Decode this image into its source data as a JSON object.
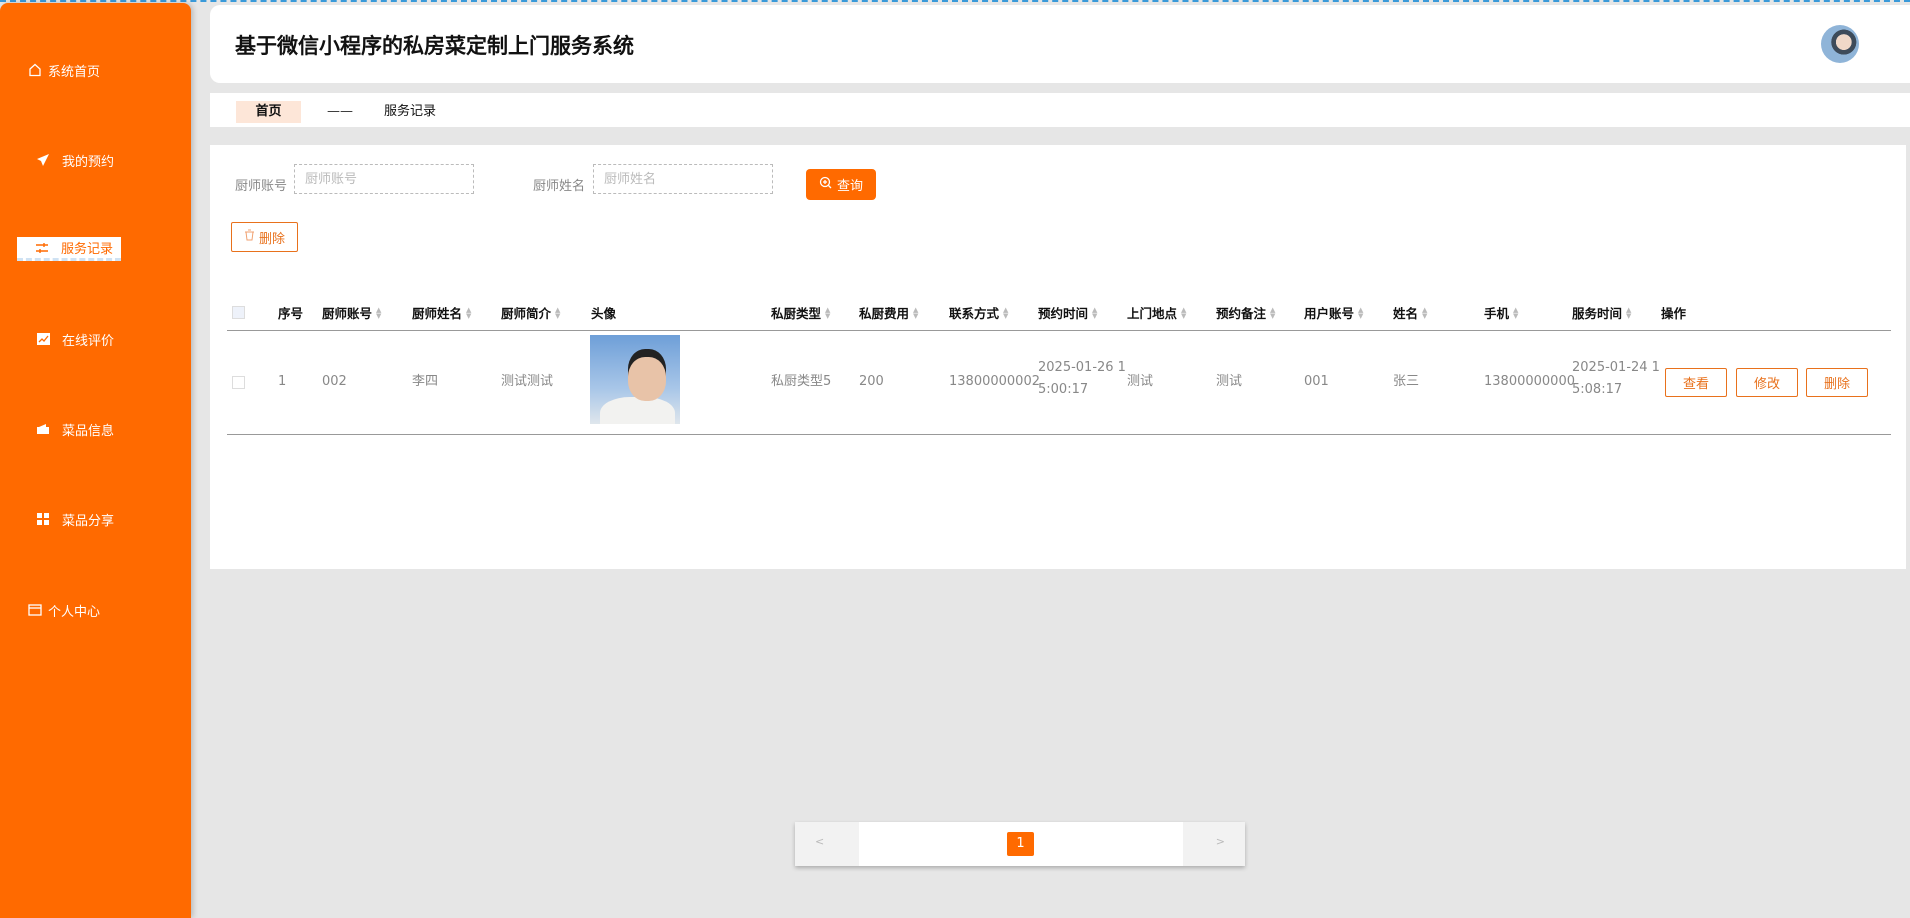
{
  "app": {
    "title": "基于微信小程序的私房菜定制上门服务系统",
    "accent": "#ff6a00"
  },
  "sidebar": {
    "items": [
      {
        "label": "系统首页",
        "icon": "home-icon"
      },
      {
        "label": "我的预约",
        "icon": "paper-plane-icon"
      },
      {
        "label": "服务记录",
        "icon": "sliders-icon",
        "active": true
      },
      {
        "label": "在线评价",
        "icon": "chart-icon"
      },
      {
        "label": "菜品信息",
        "icon": "wallet-icon"
      },
      {
        "label": "菜品分享",
        "icon": "grid-icon"
      },
      {
        "label": "个人中心",
        "icon": "card-icon"
      }
    ]
  },
  "breadcrumb": {
    "home": "首页",
    "separator": "——",
    "current": "服务记录"
  },
  "search": {
    "chef_account_label": "厨师账号",
    "chef_account_placeholder": "厨师账号",
    "chef_account_value": "",
    "chef_name_label": "厨师姓名",
    "chef_name_placeholder": "厨师姓名",
    "chef_name_value": "",
    "query_label": "查询"
  },
  "toolbar": {
    "delete_label": "删除"
  },
  "table": {
    "columns": [
      "序号",
      "厨师账号",
      "厨师姓名",
      "厨师简介",
      "头像",
      "私厨类型",
      "私厨费用",
      "联系方式",
      "预约时间",
      "上门地点",
      "预约备注",
      "用户账号",
      "姓名",
      "手机",
      "服务时间",
      "操作"
    ],
    "sortable": [
      false,
      true,
      true,
      true,
      false,
      true,
      true,
      true,
      true,
      true,
      true,
      true,
      true,
      true,
      true,
      false
    ],
    "rows": [
      {
        "index": "1",
        "chef_account": "002",
        "chef_name": "李四",
        "chef_intro": "测试测试",
        "private_type": "私厨类型5",
        "fee": "200",
        "contact": "13800000002",
        "booking_time_1": "2025-01-26 1",
        "booking_time_2": "5:00:17",
        "location": "测试",
        "remark": "测试",
        "user_account": "001",
        "name": "张三",
        "phone": "13800000000",
        "service_time_1": "2025-01-24 1",
        "service_time_2": "5:08:17",
        "actions": {
          "view": "查看",
          "edit": "修改",
          "delete": "删除"
        }
      }
    ]
  },
  "pagination": {
    "prev": "<",
    "current": "1",
    "next": ">"
  }
}
